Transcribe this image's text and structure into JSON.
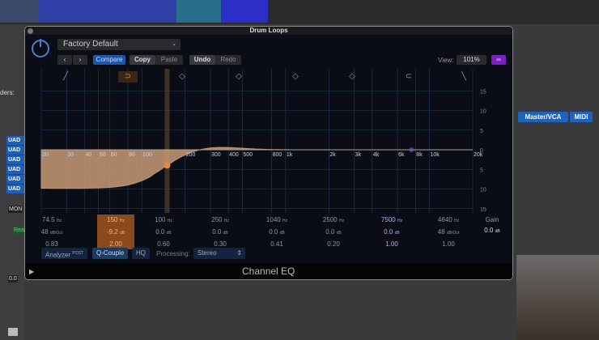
{
  "daw": {
    "inserts": [
      "UAD F",
      "UAD N",
      "UAD A",
      "UAD S",
      "UAD N",
      "UAD A"
    ],
    "tabs": [
      "Master/VCA",
      "MIDI"
    ],
    "mon": "MON",
    "read": "Read",
    "fader_value": "0.0",
    "views_label": "ders:"
  },
  "plugin": {
    "window_title": "Drum Loops",
    "preset": "Factory Default",
    "buttons": {
      "compare": "Compare",
      "copy": "Copy",
      "paste": "Paste",
      "undo": "Undo",
      "redo": "Redo"
    },
    "view_label": "View:",
    "view_value": "101%",
    "footer_title": "Channel EQ",
    "controls": {
      "analyzer": "Analyzer",
      "analyzer_sup": "POST",
      "q_couple": "Q-Couple",
      "hq": "HQ",
      "processing_label": "Processing:",
      "processing_value": "Stereo"
    },
    "gain": {
      "label": "Gain",
      "value": "0.0",
      "unit": "dB"
    },
    "bands": [
      {
        "freq": "74.5",
        "fu": "Hz",
        "gain": "48",
        "gu": "dB/Oct",
        "q": "0.83"
      },
      {
        "freq": "150",
        "fu": "Hz",
        "gain": "-9.2",
        "gu": "dB",
        "q": "2.00"
      },
      {
        "freq": "100",
        "fu": "Hz",
        "gain": "0.0",
        "gu": "dB",
        "q": "0.60"
      },
      {
        "freq": "250",
        "fu": "Hz",
        "gain": "0.0",
        "gu": "dB",
        "q": "0.30"
      },
      {
        "freq": "1040",
        "fu": "Hz",
        "gain": "0.0",
        "gu": "dB",
        "q": "0.41"
      },
      {
        "freq": "2500",
        "fu": "Hz",
        "gain": "0.0",
        "gu": "dB",
        "q": "0.20"
      },
      {
        "freq": "7500",
        "fu": "Hz",
        "gain": "0.0",
        "gu": "dB",
        "q": "1.00"
      },
      {
        "freq": "4640",
        "fu": "Hz",
        "gain": "48",
        "gu": "dB/Oct",
        "q": "1.00"
      }
    ],
    "y_ticks": [
      "15",
      "10",
      "5",
      "0",
      "5",
      "10",
      "15"
    ],
    "x_ticks": [
      [
        "20",
        20
      ],
      [
        "30",
        30
      ],
      [
        "40",
        40
      ],
      [
        "50",
        50
      ],
      [
        "60",
        60
      ],
      [
        "80",
        80
      ],
      [
        "100",
        100
      ],
      [
        "200",
        200
      ],
      [
        "300",
        300
      ],
      [
        "400",
        400
      ],
      [
        "500",
        500
      ],
      [
        "800",
        800
      ],
      [
        "1k",
        1000
      ],
      [
        "2k",
        2000
      ],
      [
        "3k",
        3000
      ],
      [
        "4k",
        4000
      ],
      [
        "6k",
        6000
      ],
      [
        "8k",
        8000
      ],
      [
        "10k",
        10000
      ],
      [
        "20k",
        20000
      ]
    ],
    "accent": "#e8873a"
  }
}
